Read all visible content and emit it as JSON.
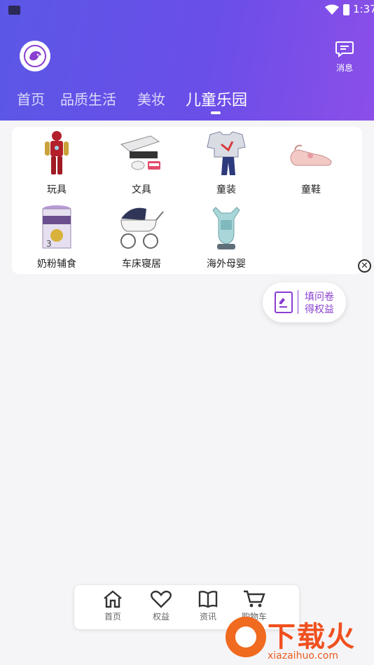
{
  "status_bar": {
    "time": "1:37"
  },
  "header": {
    "message_label": "消息",
    "tabs": [
      {
        "label": "首页",
        "active": false
      },
      {
        "label": "品质生活",
        "active": false
      },
      {
        "label": "美妆",
        "active": false
      },
      {
        "label": "儿童乐园",
        "active": true
      }
    ]
  },
  "categories": [
    {
      "label": "玩具",
      "icon": "toy-figure-icon"
    },
    {
      "label": "文具",
      "icon": "stationery-icon"
    },
    {
      "label": "童装",
      "icon": "kids-clothing-icon"
    },
    {
      "label": "童鞋",
      "icon": "kids-shoe-icon"
    },
    {
      "label": "奶粉辅食",
      "icon": "milk-powder-icon"
    },
    {
      "label": "车床寝居",
      "icon": "stroller-icon"
    },
    {
      "label": "海外母婴",
      "icon": "baby-carrier-icon"
    }
  ],
  "survey": {
    "line1": "填问卷",
    "line2": "得权益"
  },
  "bottom_nav": [
    {
      "label": "首页",
      "icon": "home-icon"
    },
    {
      "label": "权益",
      "icon": "heart-icon"
    },
    {
      "label": "资讯",
      "icon": "book-icon"
    },
    {
      "label": "购物车",
      "icon": "cart-icon"
    }
  ],
  "watermark": {
    "title": "下载火",
    "url": "xiazaihuo.com"
  },
  "colors": {
    "header_start": "#5b57e6",
    "header_end": "#8b4fe8",
    "accent": "#8a3fd0",
    "watermark": "#f0501f"
  }
}
